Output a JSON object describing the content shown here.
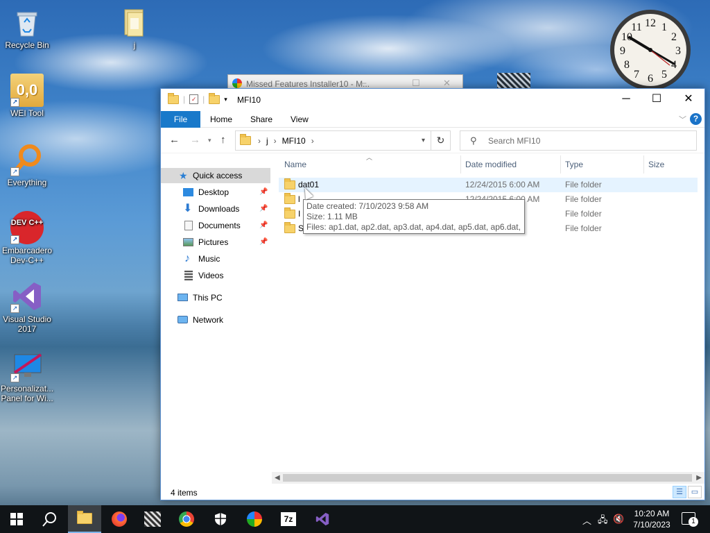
{
  "desktop": {
    "icons": [
      {
        "label": "Recycle Bin"
      },
      {
        "label": "j"
      },
      {
        "label": "WEI Tool",
        "glyph": "0,0"
      },
      {
        "label": "Everything"
      },
      {
        "label": "Embarcadero Dev-C++",
        "glyph": "DEV C++"
      },
      {
        "label": "Visual Studio 2017"
      },
      {
        "label": "Personalizat... Panel for Wi..."
      }
    ],
    "clock_numbers": [
      "12",
      "1",
      "2",
      "3",
      "4",
      "5",
      "6",
      "7",
      "8",
      "9",
      "10",
      "11"
    ]
  },
  "background_window": {
    "title": "Missed Features Installer10 - M..."
  },
  "explorer": {
    "title": "MFI10",
    "controls": {
      "minimize": "─",
      "maximize": "☐",
      "close": "✕"
    },
    "ribbon_tabs": [
      "File",
      "Home",
      "Share",
      "View"
    ],
    "address": {
      "parts": [
        "j",
        "MFI10"
      ]
    },
    "search": {
      "placeholder": "Search MFI10"
    },
    "nav": {
      "quick_access": "Quick access",
      "items": [
        "Desktop",
        "Downloads",
        "Documents",
        "Pictures",
        "Music",
        "Videos"
      ],
      "this_pc": "This PC",
      "network": "Network"
    },
    "columns": [
      "Name",
      "Date modified",
      "Type",
      "Size"
    ],
    "files": [
      {
        "name": "dat01",
        "date": "12/24/2015 6:00 AM",
        "type": "File folder"
      },
      {
        "name": "l",
        "date": "12/24/2015 6:00 AM",
        "type": "File folder"
      },
      {
        "name": "I",
        "date": "",
        "type": "File folder"
      },
      {
        "name": "S",
        "date": "",
        "type": "File folder"
      }
    ],
    "tooltip": {
      "created": "Date created: 7/10/2023 9:58 AM",
      "size": "Size: 1.11 MB",
      "files": "Files: ap1.dat, ap2.dat, ap3.dat, ap4.dat, ap5.dat, ap6.dat, ..."
    },
    "status": {
      "count": "4 items"
    }
  },
  "taskbar": {
    "clock": {
      "time": "10:20 AM",
      "date": "7/10/2023"
    },
    "notifications": "1",
    "ui_colors": {
      "accent": "#1979ca",
      "taskbar": "#101417"
    }
  }
}
